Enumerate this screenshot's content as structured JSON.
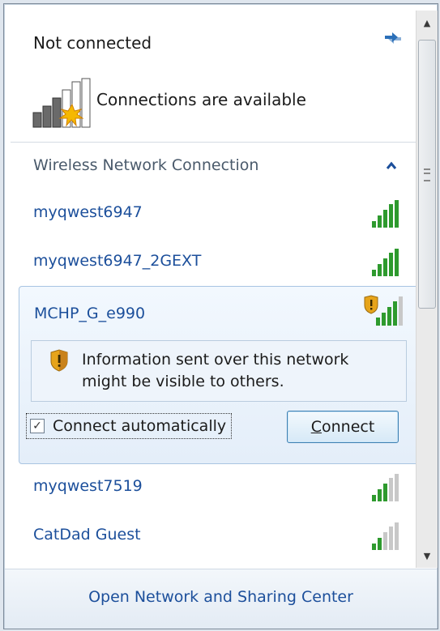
{
  "status": {
    "title": "Not connected",
    "available_text": "Connections are available",
    "refresh_icon": "refresh-icon",
    "signal_icon": "signal-starburst-icon"
  },
  "section": {
    "title": "Wireless Network Connection",
    "collapse_icon": "chevron-up-icon"
  },
  "networks": [
    {
      "name": "myqwest6947",
      "signal_level": 5,
      "secured": true
    },
    {
      "name": "myqwest6947_2GEXT",
      "signal_level": 5,
      "secured": true
    },
    {
      "name": "MCHP_G_e990",
      "signal_level": 4,
      "secured": false
    },
    {
      "name": "myqwest7519",
      "signal_level": 3,
      "secured": true
    },
    {
      "name": "CatDad Guest",
      "signal_level": 2,
      "secured": true
    }
  ],
  "expanded": {
    "name": "MCHP_G_e990",
    "warning": "Information sent over this network might be visible to others.",
    "auto_label": "Connect automatically",
    "auto_checked": true,
    "connect_label": "Connect",
    "connect_label_first": "C",
    "connect_label_rest": "onnect"
  },
  "footer": {
    "link": "Open Network and Sharing Center"
  },
  "colors": {
    "link": "#1c4f9b",
    "signal_on": "#2e9a2e",
    "signal_off": "#c8c8c8",
    "warning_shield": "#e6a41b"
  }
}
